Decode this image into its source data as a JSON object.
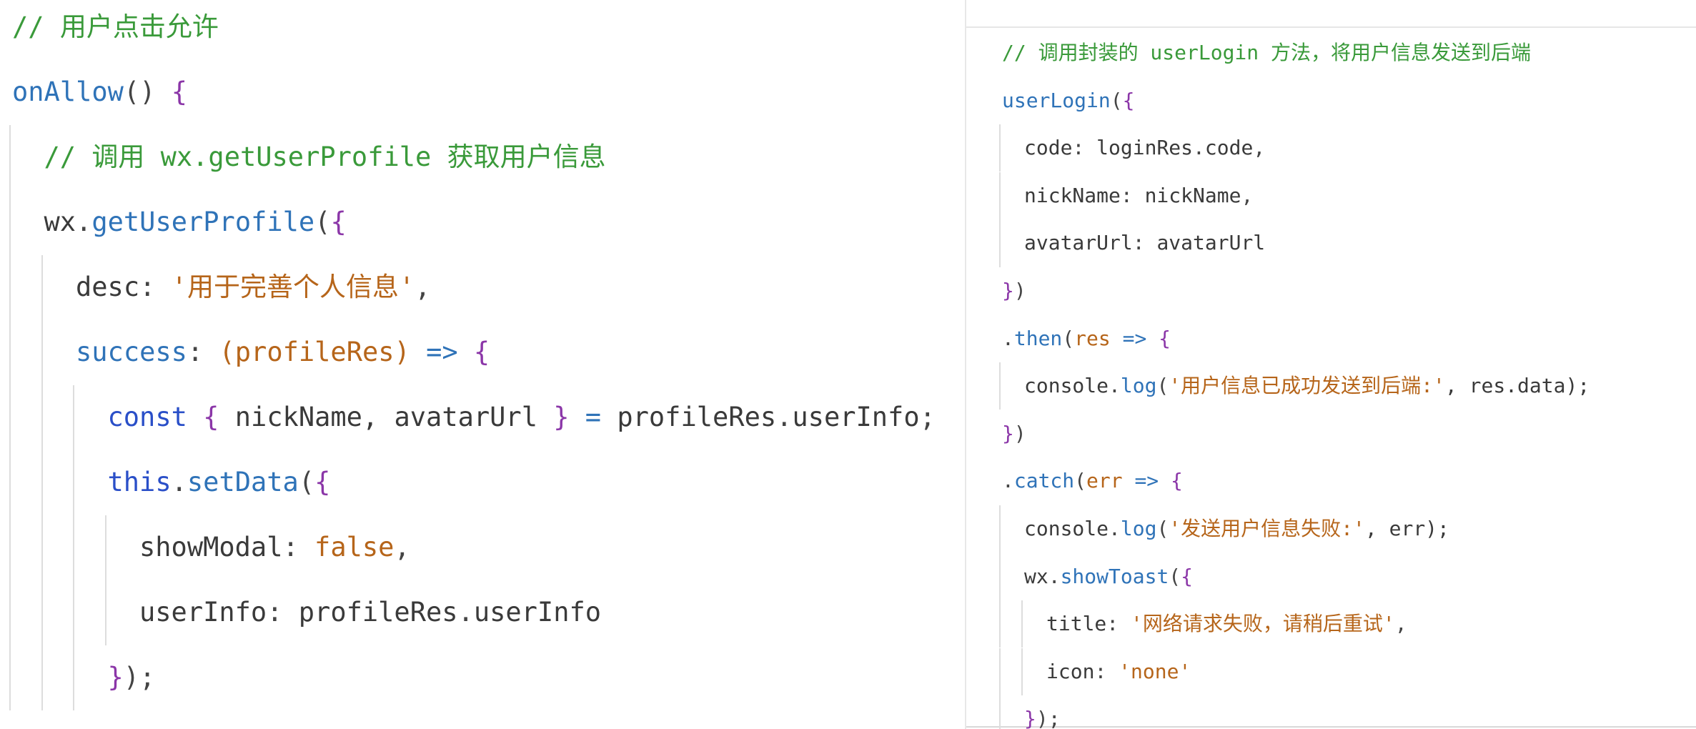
{
  "left_code": {
    "lines": [
      {
        "indent": 0,
        "tokens": [
          {
            "t": "// 用户点击允许",
            "c": "comment"
          }
        ]
      },
      {
        "indent": 0,
        "tokens": [
          {
            "t": "onAllow",
            "c": "fn"
          },
          {
            "t": "() ",
            "c": "punc"
          },
          {
            "t": "{",
            "c": "brace"
          }
        ]
      },
      {
        "indent": 1,
        "tokens": [
          {
            "t": "// 调用 wx.getUserProfile 获取用户信息",
            "c": "comment"
          }
        ]
      },
      {
        "indent": 1,
        "tokens": [
          {
            "t": "wx",
            "c": "id"
          },
          {
            "t": ".",
            "c": "punc"
          },
          {
            "t": "getUserProfile",
            "c": "fn"
          },
          {
            "t": "(",
            "c": "punc"
          },
          {
            "t": "{",
            "c": "brace"
          }
        ]
      },
      {
        "indent": 2,
        "tokens": [
          {
            "t": "desc",
            "c": "id"
          },
          {
            "t": ": ",
            "c": "punc"
          },
          {
            "t": "'用于完善个人信息'",
            "c": "str"
          },
          {
            "t": ",",
            "c": "punc"
          }
        ]
      },
      {
        "indent": 2,
        "tokens": [
          {
            "t": "success",
            "c": "fn"
          },
          {
            "t": ": ",
            "c": "punc"
          },
          {
            "t": "(profileRes)",
            "c": "param"
          },
          {
            "t": " => ",
            "c": "op"
          },
          {
            "t": "{",
            "c": "brace"
          }
        ]
      },
      {
        "indent": 3,
        "tokens": [
          {
            "t": "const",
            "c": "kw"
          },
          {
            "t": " ",
            "c": "punc"
          },
          {
            "t": "{",
            "c": "brace"
          },
          {
            "t": " nickName, avatarUrl ",
            "c": "id"
          },
          {
            "t": "}",
            "c": "brace"
          },
          {
            "t": " = ",
            "c": "op"
          },
          {
            "t": "profileRes",
            "c": "id"
          },
          {
            "t": ".",
            "c": "punc"
          },
          {
            "t": "userInfo",
            "c": "id"
          },
          {
            "t": ";",
            "c": "punc"
          }
        ]
      },
      {
        "indent": 3,
        "tokens": [
          {
            "t": "this",
            "c": "kw"
          },
          {
            "t": ".",
            "c": "punc"
          },
          {
            "t": "setData",
            "c": "fn"
          },
          {
            "t": "(",
            "c": "punc"
          },
          {
            "t": "{",
            "c": "brace"
          }
        ]
      },
      {
        "indent": 4,
        "tokens": [
          {
            "t": "showModal",
            "c": "id"
          },
          {
            "t": ": ",
            "c": "punc"
          },
          {
            "t": "false",
            "c": "bool"
          },
          {
            "t": ",",
            "c": "punc"
          }
        ]
      },
      {
        "indent": 4,
        "tokens": [
          {
            "t": "userInfo",
            "c": "id"
          },
          {
            "t": ": ",
            "c": "punc"
          },
          {
            "t": "profileRes",
            "c": "id"
          },
          {
            "t": ".",
            "c": "punc"
          },
          {
            "t": "userInfo",
            "c": "id"
          }
        ]
      },
      {
        "indent": 3,
        "tokens": [
          {
            "t": "}",
            "c": "brace"
          },
          {
            "t": ");",
            "c": "punc"
          }
        ]
      }
    ]
  },
  "right_code": {
    "lines": [
      {
        "indent": 0,
        "tokens": [
          {
            "t": "// 调用封装的 userLogin 方法，将用户信息发送到后端",
            "c": "comment"
          }
        ]
      },
      {
        "indent": 0,
        "tokens": [
          {
            "t": "userLogin",
            "c": "fn"
          },
          {
            "t": "(",
            "c": "punc"
          },
          {
            "t": "{",
            "c": "brace"
          }
        ]
      },
      {
        "indent": 1,
        "tokens": [
          {
            "t": "code",
            "c": "id"
          },
          {
            "t": ": ",
            "c": "punc"
          },
          {
            "t": "loginRes",
            "c": "id"
          },
          {
            "t": ".",
            "c": "punc"
          },
          {
            "t": "code",
            "c": "id"
          },
          {
            "t": ",",
            "c": "punc"
          }
        ]
      },
      {
        "indent": 1,
        "tokens": [
          {
            "t": "nickName",
            "c": "id"
          },
          {
            "t": ": ",
            "c": "punc"
          },
          {
            "t": "nickName",
            "c": "id"
          },
          {
            "t": ",",
            "c": "punc"
          }
        ]
      },
      {
        "indent": 1,
        "tokens": [
          {
            "t": "avatarUrl",
            "c": "id"
          },
          {
            "t": ": ",
            "c": "punc"
          },
          {
            "t": "avatarUrl",
            "c": "id"
          }
        ]
      },
      {
        "indent": 0,
        "tokens": [
          {
            "t": "}",
            "c": "brace"
          },
          {
            "t": ")",
            "c": "punc"
          }
        ]
      },
      {
        "indent": 0,
        "tokens": [
          {
            "t": ".",
            "c": "punc"
          },
          {
            "t": "then",
            "c": "fn"
          },
          {
            "t": "(",
            "c": "punc"
          },
          {
            "t": "res",
            "c": "param"
          },
          {
            "t": " => ",
            "c": "op"
          },
          {
            "t": "{",
            "c": "brace"
          }
        ]
      },
      {
        "indent": 1,
        "tokens": [
          {
            "t": "console",
            "c": "id"
          },
          {
            "t": ".",
            "c": "punc"
          },
          {
            "t": "log",
            "c": "fn"
          },
          {
            "t": "(",
            "c": "punc"
          },
          {
            "t": "'用户信息已成功发送到后端:'",
            "c": "str"
          },
          {
            "t": ", res.data);",
            "c": "id"
          }
        ]
      },
      {
        "indent": 0,
        "tokens": [
          {
            "t": "}",
            "c": "brace"
          },
          {
            "t": ")",
            "c": "punc"
          }
        ]
      },
      {
        "indent": 0,
        "tokens": [
          {
            "t": ".",
            "c": "punc"
          },
          {
            "t": "catch",
            "c": "fn"
          },
          {
            "t": "(",
            "c": "punc"
          },
          {
            "t": "err",
            "c": "param"
          },
          {
            "t": " => ",
            "c": "op"
          },
          {
            "t": "{",
            "c": "brace"
          }
        ]
      },
      {
        "indent": 1,
        "tokens": [
          {
            "t": "console",
            "c": "id"
          },
          {
            "t": ".",
            "c": "punc"
          },
          {
            "t": "log",
            "c": "fn"
          },
          {
            "t": "(",
            "c": "punc"
          },
          {
            "t": "'发送用户信息失败:'",
            "c": "str"
          },
          {
            "t": ", err);",
            "c": "id"
          }
        ]
      },
      {
        "indent": 1,
        "tokens": [
          {
            "t": "wx",
            "c": "id"
          },
          {
            "t": ".",
            "c": "punc"
          },
          {
            "t": "showToast",
            "c": "fn"
          },
          {
            "t": "(",
            "c": "punc"
          },
          {
            "t": "{",
            "c": "brace"
          }
        ]
      },
      {
        "indent": 2,
        "tokens": [
          {
            "t": "title",
            "c": "id"
          },
          {
            "t": ": ",
            "c": "punc"
          },
          {
            "t": "'网络请求失败，请稍后重试'",
            "c": "str"
          },
          {
            "t": ",",
            "c": "punc"
          }
        ]
      },
      {
        "indent": 2,
        "tokens": [
          {
            "t": "icon",
            "c": "id"
          },
          {
            "t": ": ",
            "c": "punc"
          },
          {
            "t": "'none'",
            "c": "str"
          }
        ]
      },
      {
        "indent": 1,
        "tokens": [
          {
            "t": "}",
            "c": "brace"
          },
          {
            "t": ");",
            "c": "punc"
          }
        ]
      }
    ]
  }
}
